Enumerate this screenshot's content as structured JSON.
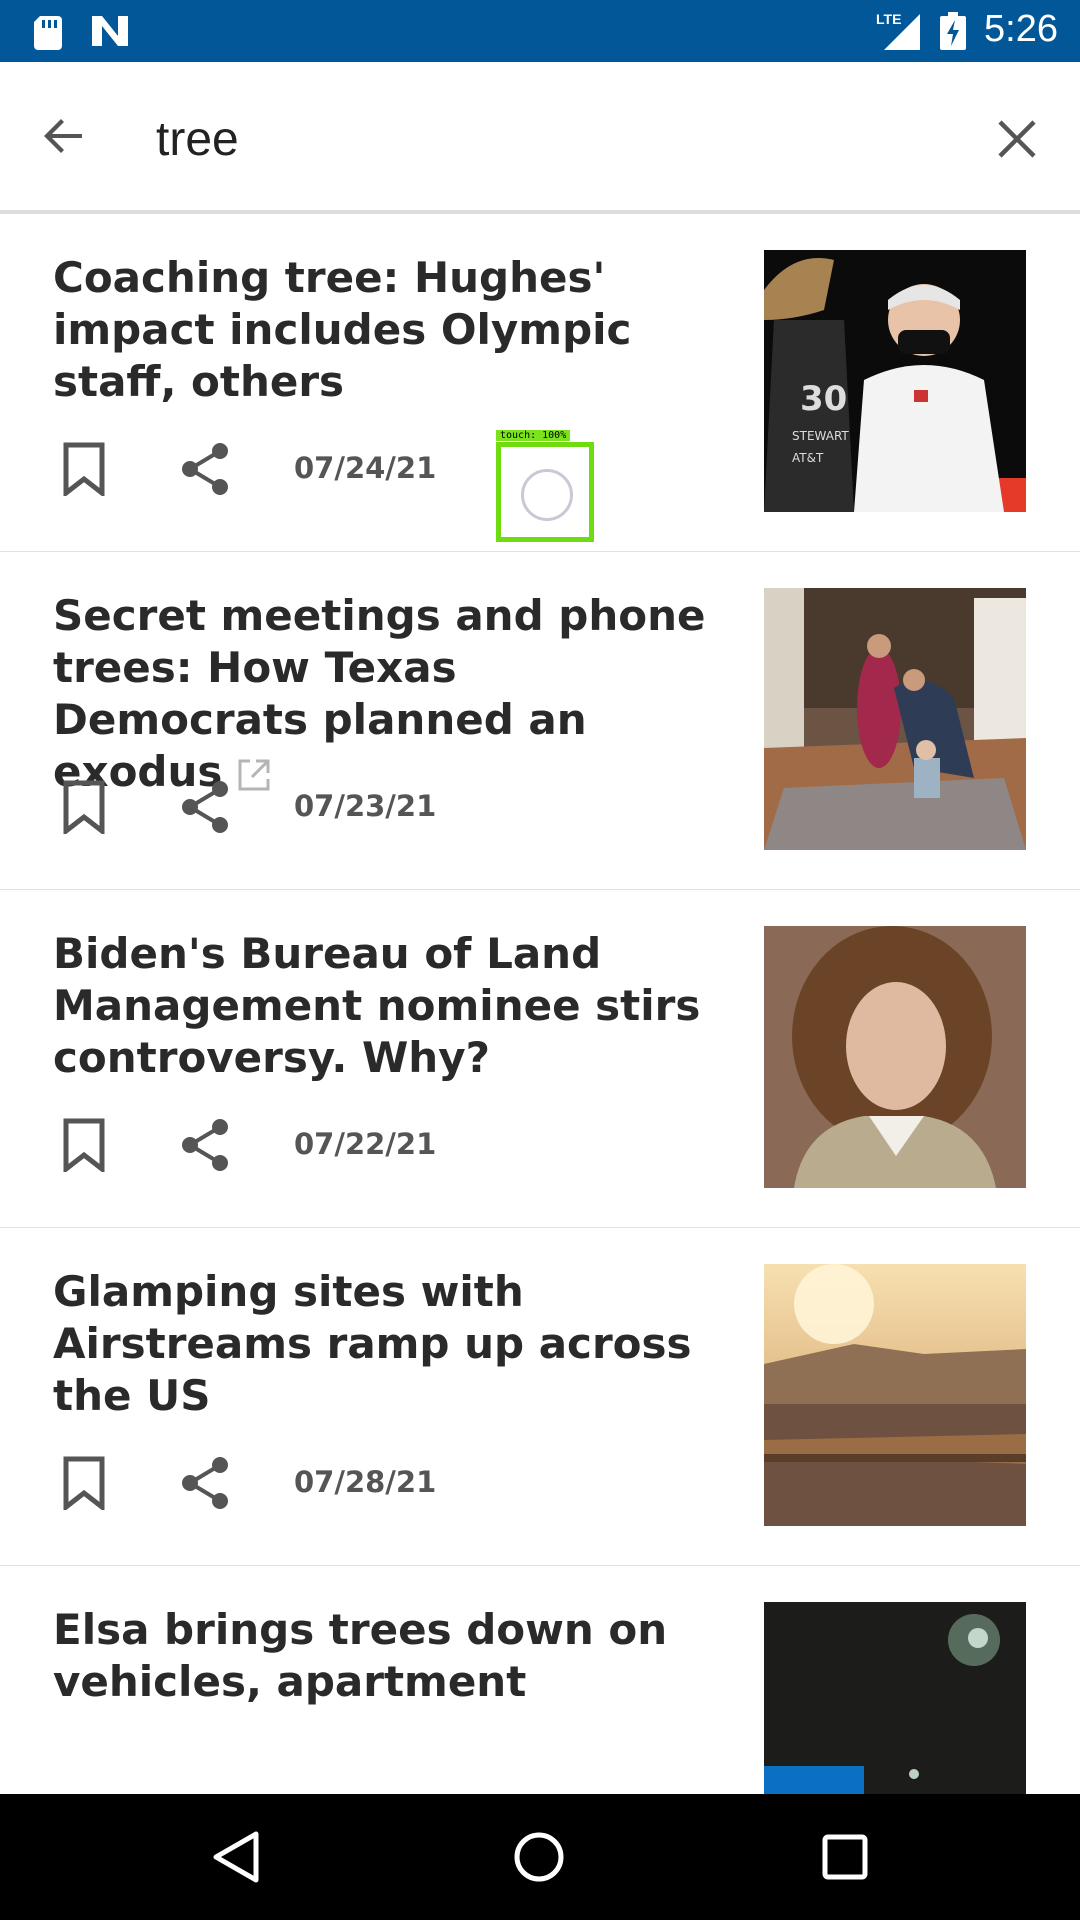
{
  "status_bar": {
    "time": "5:26",
    "network": "LTE",
    "icons": [
      "sd-card-icon",
      "notification-n-icon",
      "lte-signal-icon",
      "battery-charging-icon"
    ]
  },
  "search": {
    "query": "tree",
    "back_icon": "arrow-left-icon",
    "clear_icon": "close-icon"
  },
  "articles": [
    {
      "title": "Coaching tree: Hughes' impact includes Olympic staff, others",
      "date": "07/24/21",
      "external": false
    },
    {
      "title": "Secret meetings and phone trees: How Texas Democrats planned an exodus",
      "date": "07/23/21",
      "external": true
    },
    {
      "title": "Biden's Bureau of Land Management nominee stirs controversy. Why?",
      "date": "07/22/21",
      "external": false
    },
    {
      "title": "Glamping sites with Airstreams ramp up across the US",
      "date": "07/28/21",
      "external": false
    },
    {
      "title": "Elsa brings trees down on vehicles, apartment",
      "date": "",
      "external": false
    }
  ],
  "touch_indicator": {
    "label": "touch: 100%"
  },
  "nav_bar": {
    "icons": [
      "back-triangle-icon",
      "home-circle-icon",
      "recents-square-icon"
    ]
  }
}
